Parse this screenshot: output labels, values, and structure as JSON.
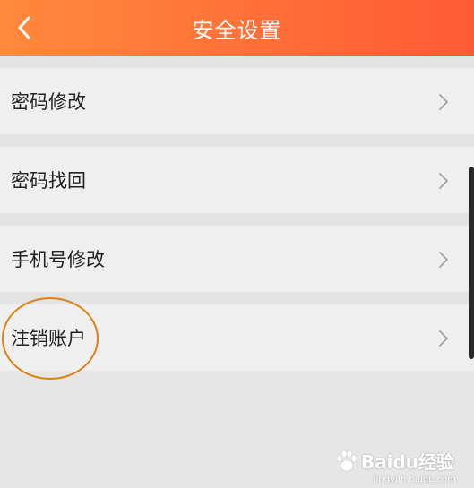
{
  "header": {
    "title": "安全设置",
    "back_icon": "chevron-left-icon",
    "background_start": "#ff8a3d",
    "background_end": "#ff5a36"
  },
  "menu": {
    "items": [
      {
        "label": "密码修改",
        "icon": "chevron-right-icon"
      },
      {
        "label": "密码找回",
        "icon": "chevron-right-icon"
      },
      {
        "label": "手机号修改",
        "icon": "chevron-right-icon"
      },
      {
        "label": "注销账户",
        "icon": "chevron-right-icon"
      }
    ]
  },
  "annotation": {
    "highlight_color": "#e07f12"
  },
  "watermark": {
    "brand": "Baidu经验",
    "url": "jingyan.baidu.com"
  }
}
